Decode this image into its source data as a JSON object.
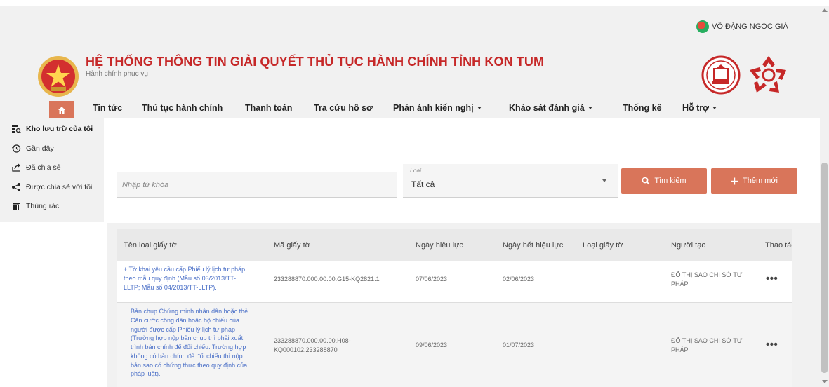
{
  "user": {
    "name": "VÕ ĐẶNG NGỌC GIÁ"
  },
  "header": {
    "title": "HỆ THỐNG THÔNG TIN GIẢI QUYẾT THỦ TỤC HÀNH CHÍNH   TỈNH KON TUM",
    "subtitle": "Hành chính phục vụ"
  },
  "nav": {
    "items": [
      {
        "label": "Tin tức",
        "dropdown": false
      },
      {
        "label": "Thủ tục hành chính",
        "dropdown": false
      },
      {
        "label": "Thanh toán",
        "dropdown": false
      },
      {
        "label": "Tra cứu hồ sơ",
        "dropdown": false
      },
      {
        "label": "Phản ánh kiến nghị",
        "dropdown": true
      },
      {
        "label": "Khảo sát đánh giá",
        "dropdown": true
      },
      {
        "label": "Thống kê",
        "dropdown": false
      },
      {
        "label": "Hỗ trợ",
        "dropdown": true
      }
    ]
  },
  "sidebar": {
    "items": [
      {
        "label": "Kho lưu trữ của tôi",
        "icon": "storage-search-icon",
        "active": true
      },
      {
        "label": "Gần đây",
        "icon": "history-icon",
        "active": false
      },
      {
        "label": "Đã chia sẻ",
        "icon": "shared-out-icon",
        "active": false
      },
      {
        "label": "Được chia sẻ với tôi",
        "icon": "share-icon",
        "active": false
      },
      {
        "label": "Thùng rác",
        "icon": "trash-icon",
        "active": false
      }
    ]
  },
  "search": {
    "placeholder": "Nhập từ khóa",
    "type_label": "Loại",
    "type_value": "Tất cả",
    "search_button": "Tìm kiếm",
    "add_button": "Thêm mới"
  },
  "table": {
    "headers": [
      "Tên loại giấy tờ",
      "Mã giấy tờ",
      "Ngày hiệu lực",
      "Ngày hết hiệu lực",
      "Loại giấy tờ",
      "Người tạo",
      "Thao tác"
    ],
    "rows": [
      {
        "name_lines": [
          "+ Tờ khai yêu cầu cấp Phiếu lý lịch tư pháp",
          "theo mẫu quy định (Mẫu số 03/2013/TT-",
          "LLTP; Mẫu số 04/2013/TT-LLTP)."
        ],
        "code_lines": [
          "233288870.000.00.00.G15-KQ2821.1"
        ],
        "valid_from": "07/06/2023",
        "valid_to": "02/06/2023",
        "doc_type": "",
        "creator_lines": [
          "ĐỖ THỊ SAO CHI SỞ TƯ",
          "PHÁP"
        ],
        "action": "•••"
      },
      {
        "name_lines": [
          "Bản chụp Chứng minh nhân dân hoặc thẻ",
          "Căn cước công dân hoặc hộ chiếu của",
          "người được cấp Phiếu lý lịch tư pháp",
          "(Trường hợp nộp bản chụp thì phải xuất",
          "trình bản chính để đối chiếu. Trường hợp",
          "không có bản chính để đối chiếu thì nộp",
          "bản sao có chứng thực theo quy định của",
          "pháp luật)."
        ],
        "code_lines": [
          "233288870.000.00.00.H08-",
          "KQ000102.233288870"
        ],
        "valid_from": "09/06/2023",
        "valid_to": "01/07/2023",
        "doc_type": "",
        "creator_lines": [
          "ĐỖ THỊ SAO CHI SỞ TƯ",
          "PHÁP"
        ],
        "action": "•••"
      }
    ]
  },
  "colors": {
    "accent": "#d9755a",
    "title_red": "#c62828",
    "link": "#4a6fc7"
  }
}
